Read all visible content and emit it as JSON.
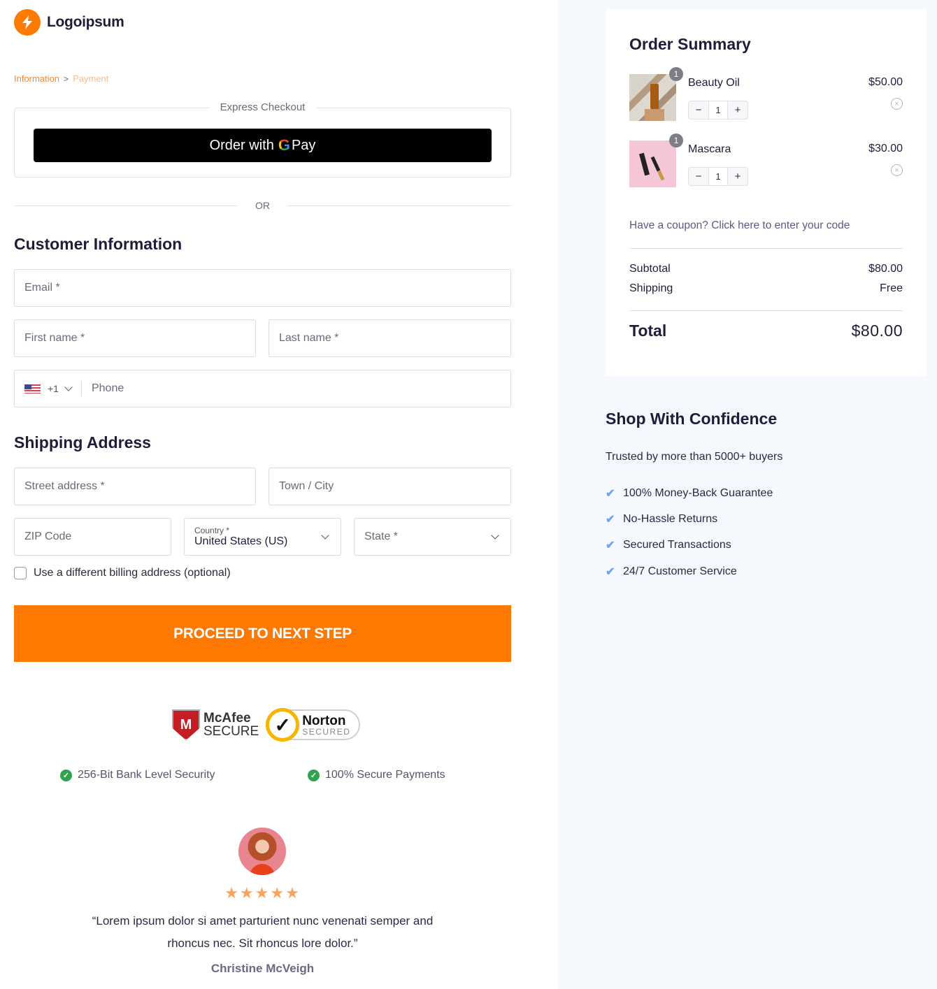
{
  "brand": {
    "name": "Logoipsum",
    "icon": "lightning-bolt-icon",
    "accent_color": "#ff7a00"
  },
  "breadcrumb": {
    "items": [
      "Information",
      "Payment"
    ],
    "separator": ">"
  },
  "express_checkout": {
    "label": "Express Checkout",
    "button_prefix": "Order with",
    "button_g": "G",
    "button_suffix": "Pay"
  },
  "or_label": "OR",
  "customer_info": {
    "title": "Customer Information",
    "email_placeholder": "Email *",
    "first_name_placeholder": "First name *",
    "last_name_placeholder": "Last name *",
    "phone_code": "+1",
    "phone_placeholder": "Phone"
  },
  "shipping": {
    "title": "Shipping Address",
    "street_placeholder": "Street address *",
    "city_placeholder": "Town / City",
    "zip_placeholder": "ZIP Code",
    "country_label": "Country *",
    "country_value": "United States (US)",
    "state_placeholder": "State *",
    "billing_checkbox_label": "Use a different billing address (optional)",
    "billing_checked": false
  },
  "proceed_button": "PROCEED TO NEXT STEP",
  "badges": {
    "mcafee": {
      "shield": "M",
      "line1": "McAfee",
      "line2": "SECURE"
    },
    "norton": {
      "check": "✓",
      "line1": "Norton",
      "line2": "SECURED"
    }
  },
  "security": [
    "256-Bit Bank Level Security",
    "100% Secure Payments"
  ],
  "testimonial": {
    "rating": 5,
    "stars": "★★★★★",
    "quote": "“Lorem ipsum dolor si amet parturient nunc venenati semper and rhoncus nec. Sit rhoncus lore dolor.”",
    "author": "Christine McVeigh"
  },
  "order_summary": {
    "title": "Order Summary",
    "items": [
      {
        "name": "Beauty Oil",
        "price": "$50.00",
        "quantity": "1",
        "badge": "1"
      },
      {
        "name": "Mascara",
        "price": "$30.00",
        "quantity": "1",
        "badge": "1"
      }
    ],
    "minus": "−",
    "plus": "+",
    "remove": "×",
    "coupon_text": "Have a coupon? Click here to enter your code",
    "subtotal_label": "Subtotal",
    "subtotal_value": "$80.00",
    "shipping_label": "Shipping",
    "shipping_value": "Free",
    "total_label": "Total",
    "total_value": "$80.00"
  },
  "confidence": {
    "title": "Shop With Confidence",
    "subtitle": "Trusted by more than 5000+ buyers",
    "check": "✔",
    "items": [
      "100% Money-Back Guarantee",
      "No-Hassle Returns",
      "Secured Transactions",
      "24/7 Customer Service"
    ]
  }
}
